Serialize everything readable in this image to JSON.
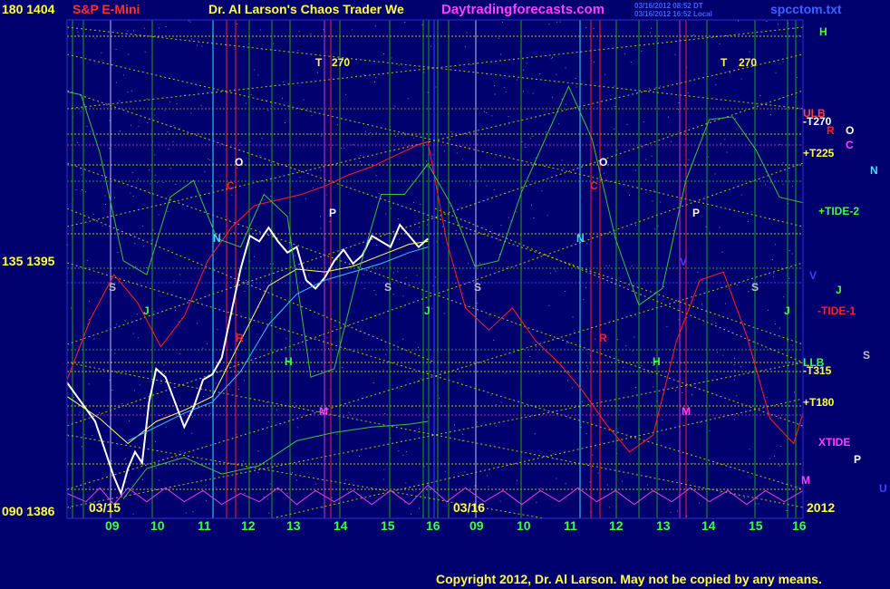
{
  "header": {
    "instrument": "S&P E-Mini",
    "title": "Dr. Al Larson's Chaos Trader We",
    "site": "Daytradingforecasts.com",
    "timestamp_1": "03/16/2012 08:52 DT",
    "timestamp_2": "03/16/2012 16:52 Local",
    "file": "spcctom.txt"
  },
  "copyright": "Copyright 2012, Dr. Al Larson. May not be copied by any means.",
  "y_axis": {
    "ticks": [
      {
        "label": "180  1404",
        "price": 1404
      },
      {
        "label": "135  1395",
        "price": 1395
      },
      {
        "label": "090  1386",
        "price": 1386
      }
    ]
  },
  "x_axis": {
    "day_labels": [
      "03/15",
      "03/16"
    ],
    "year_label": "2012",
    "hour_labels": [
      "09",
      "10",
      "11",
      "12",
      "13",
      "14",
      "15",
      "16",
      "09",
      "10",
      "11",
      "12",
      "13",
      "14",
      "15",
      "16"
    ]
  },
  "right_labels": [
    {
      "text": "H",
      "color": "#40ff40"
    },
    {
      "text": "ULB",
      "color": "#ff4040"
    },
    {
      "text": "-T270",
      "color": "#ffffff"
    },
    {
      "text": "R",
      "color": "#ff2020"
    },
    {
      "text": "O",
      "color": "#ffffff"
    },
    {
      "text": "C",
      "color": "#ff40ff"
    },
    {
      "text": "+T225",
      "color": "#ffff40"
    },
    {
      "text": "N",
      "color": "#40e0ff"
    },
    {
      "text": "+TIDE-2",
      "color": "#40ff40"
    },
    {
      "text": "V",
      "color": "#4040ff"
    },
    {
      "text": "J",
      "color": "#40ff40"
    },
    {
      "text": "-TIDE-1",
      "color": "#ff2020"
    },
    {
      "text": "S",
      "color": "#c0c0c0"
    },
    {
      "text": "LLB",
      "color": "#40ff40"
    },
    {
      "text": "-T315",
      "color": "#ffff40"
    },
    {
      "text": "+T180",
      "color": "#ffff40"
    },
    {
      "text": "XTIDE",
      "color": "#ff40ff"
    },
    {
      "text": "P",
      "color": "#ffffff"
    },
    {
      "text": "M",
      "color": "#ff40ff"
    },
    {
      "text": "U",
      "color": "#4040ff"
    }
  ],
  "plot_markers": [
    {
      "text": "T",
      "color": "#ffff40"
    },
    {
      "text": "270",
      "color": "#ffff40"
    },
    {
      "text": "T",
      "color": "#ffff40"
    },
    {
      "text": "270",
      "color": "#ffff40"
    },
    {
      "text": "O",
      "color": "#ffffff"
    },
    {
      "text": "C",
      "color": "#ff2020"
    },
    {
      "text": "N",
      "color": "#40e0ff"
    },
    {
      "text": "P",
      "color": "#ffffff"
    },
    {
      "text": "S",
      "color": "#c0c0c0"
    },
    {
      "text": "J",
      "color": "#40ff40"
    },
    {
      "text": "R",
      "color": "#ff2020"
    },
    {
      "text": "H",
      "color": "#40ff40"
    },
    {
      "text": "M",
      "color": "#ff40ff"
    },
    {
      "text": "S",
      "color": "#c0c0c0"
    },
    {
      "text": "O",
      "color": "#ffffff"
    },
    {
      "text": "C",
      "color": "#ff2020"
    },
    {
      "text": "N",
      "color": "#40e0ff"
    },
    {
      "text": "P",
      "color": "#ffffff"
    },
    {
      "text": "S",
      "color": "#c0c0c0"
    },
    {
      "text": "S",
      "color": "#c0c0c0"
    },
    {
      "text": "J",
      "color": "#40ff40"
    },
    {
      "text": "R",
      "color": "#ff2020"
    },
    {
      "text": "H",
      "color": "#40ff40"
    },
    {
      "text": "M",
      "color": "#ff40ff"
    },
    {
      "text": "V",
      "color": "#4040ff"
    },
    {
      "text": "J",
      "color": "#40ff40"
    }
  ],
  "chart_data": {
    "type": "line",
    "title": "S&P E-Mini",
    "ylim": [
      1386,
      1404
    ],
    "x_unit": "hour of day (03/15 then 03/16)",
    "series": [
      {
        "kind": "price",
        "color": "#ffffff",
        "points": [
          [
            8.3,
            1390.9
          ],
          [
            8.6,
            1390.2
          ],
          [
            8.9,
            1389.5
          ],
          [
            9.1,
            1388.5
          ],
          [
            9.3,
            1387.5
          ],
          [
            9.45,
            1386.9
          ],
          [
            9.6,
            1387.8
          ],
          [
            9.75,
            1388.4
          ],
          [
            9.9,
            1388.0
          ],
          [
            10.05,
            1390.2
          ],
          [
            10.2,
            1391.4
          ],
          [
            10.4,
            1391.1
          ],
          [
            10.6,
            1390.2
          ],
          [
            10.8,
            1389.3
          ],
          [
            11.0,
            1390.0
          ],
          [
            11.2,
            1391.0
          ],
          [
            11.4,
            1391.2
          ],
          [
            11.6,
            1391.8
          ],
          [
            11.8,
            1393.4
          ],
          [
            12.0,
            1395.0
          ],
          [
            12.2,
            1396.2
          ],
          [
            12.4,
            1396.0
          ],
          [
            12.6,
            1396.5
          ],
          [
            12.8,
            1396.0
          ],
          [
            13.0,
            1395.6
          ],
          [
            13.2,
            1395.8
          ],
          [
            13.4,
            1394.6
          ],
          [
            13.6,
            1394.3
          ],
          [
            13.8,
            1394.7
          ],
          [
            14.0,
            1395.3
          ],
          [
            14.2,
            1395.7
          ],
          [
            14.4,
            1395.2
          ],
          [
            14.6,
            1395.5
          ],
          [
            14.8,
            1396.2
          ],
          [
            15.0,
            1396.0
          ],
          [
            15.2,
            1395.8
          ],
          [
            15.4,
            1396.6
          ],
          [
            15.6,
            1396.2
          ],
          [
            15.8,
            1395.8
          ],
          [
            16.0,
            1396.1
          ]
        ]
      },
      {
        "kind": "moving-average",
        "color": "#ffff60",
        "points": [
          [
            8.3,
            1390.4
          ],
          [
            9.0,
            1389.6
          ],
          [
            9.6,
            1388.7
          ],
          [
            10.2,
            1389.5
          ],
          [
            10.8,
            1389.9
          ],
          [
            11.4,
            1390.4
          ],
          [
            12.0,
            1392.4
          ],
          [
            12.6,
            1394.4
          ],
          [
            13.2,
            1395.0
          ],
          [
            13.8,
            1394.9
          ],
          [
            14.4,
            1395.1
          ],
          [
            15.0,
            1395.5
          ],
          [
            15.6,
            1395.9
          ],
          [
            16.0,
            1396.0
          ]
        ]
      },
      {
        "kind": "moving-average",
        "color": "#40c0ff",
        "points": [
          [
            9.6,
            1388.8
          ],
          [
            10.2,
            1389.3
          ],
          [
            10.8,
            1389.8
          ],
          [
            11.4,
            1390.2
          ],
          [
            12.0,
            1391.3
          ],
          [
            12.6,
            1393.0
          ],
          [
            13.2,
            1394.1
          ],
          [
            13.8,
            1394.6
          ],
          [
            14.4,
            1394.9
          ],
          [
            15.0,
            1395.2
          ],
          [
            15.6,
            1395.6
          ],
          [
            16.0,
            1395.8
          ]
        ]
      },
      {
        "kind": "forecast-cycle",
        "color": "#ff2020",
        "points": [
          [
            8.3,
            1391.0
          ],
          [
            8.8,
            1393.2
          ],
          [
            9.3,
            1394.8
          ],
          [
            9.8,
            1393.8
          ],
          [
            10.3,
            1392.2
          ],
          [
            10.8,
            1393.3
          ],
          [
            11.3,
            1395.3
          ],
          [
            11.8,
            1396.5
          ],
          [
            12.3,
            1397.3
          ],
          [
            12.8,
            1397.5
          ],
          [
            13.3,
            1397.7
          ],
          [
            13.8,
            1398.0
          ],
          [
            14.3,
            1398.4
          ],
          [
            14.8,
            1398.7
          ],
          [
            15.3,
            1399.1
          ],
          [
            15.8,
            1399.5
          ],
          [
            16.0,
            1399.6
          ],
          [
            16.4,
            1396.0
          ],
          [
            16.8,
            1393.6
          ],
          [
            17.3,
            1392.8
          ],
          [
            17.8,
            1393.6
          ],
          [
            18.3,
            1392.4
          ],
          [
            18.8,
            1391.6
          ],
          [
            19.3,
            1390.6
          ],
          [
            19.8,
            1389.4
          ],
          [
            20.3,
            1388.4
          ],
          [
            20.8,
            1389.0
          ],
          [
            21.3,
            1392.4
          ],
          [
            21.8,
            1394.6
          ],
          [
            22.3,
            1394.9
          ],
          [
            22.8,
            1392.6
          ],
          [
            23.3,
            1389.6
          ],
          [
            23.8,
            1388.7
          ],
          [
            24.0,
            1389.8
          ]
        ]
      },
      {
        "kind": "forecast-cycle",
        "color": "#40c040",
        "points": [
          [
            8.3,
            1401.4
          ],
          [
            8.6,
            1401.3
          ],
          [
            9.0,
            1399.2
          ],
          [
            9.5,
            1395.3
          ],
          [
            10.0,
            1394.8
          ],
          [
            10.5,
            1397.6
          ],
          [
            11.0,
            1398.2
          ],
          [
            11.5,
            1396.1
          ],
          [
            12.0,
            1395.8
          ],
          [
            12.5,
            1397.7
          ],
          [
            13.0,
            1396.9
          ],
          [
            13.5,
            1391.1
          ],
          [
            14.0,
            1391.4
          ],
          [
            14.5,
            1394.8
          ],
          [
            15.0,
            1397.7
          ],
          [
            15.5,
            1397.7
          ],
          [
            16.0,
            1398.8
          ],
          [
            16.5,
            1397.3
          ],
          [
            17.0,
            1395.1
          ],
          [
            17.5,
            1395.3
          ],
          [
            18.0,
            1397.8
          ],
          [
            18.5,
            1399.7
          ],
          [
            19.0,
            1401.6
          ],
          [
            19.5,
            1399.7
          ],
          [
            20.0,
            1396.1
          ],
          [
            20.5,
            1393.7
          ],
          [
            21.0,
            1394.3
          ],
          [
            21.5,
            1398.2
          ],
          [
            22.0,
            1400.4
          ],
          [
            22.5,
            1400.5
          ],
          [
            23.0,
            1399.3
          ],
          [
            23.5,
            1397.6
          ],
          [
            24.0,
            1397.4
          ]
        ]
      },
      {
        "kind": "envelope",
        "color": "#40c040",
        "points": [
          [
            9.5,
            1386.7
          ],
          [
            10.0,
            1387.8
          ],
          [
            10.8,
            1388.2
          ],
          [
            11.6,
            1387.6
          ],
          [
            12.4,
            1387.9
          ],
          [
            13.2,
            1388.8
          ],
          [
            14.0,
            1389.1
          ],
          [
            14.8,
            1389.3
          ],
          [
            15.6,
            1389.4
          ],
          [
            16.0,
            1389.5
          ]
        ]
      },
      {
        "kind": "xtide-oscillator",
        "color": "#e040e0",
        "points": [
          [
            8.3,
            1386.9
          ],
          [
            8.7,
            1386.6
          ],
          [
            9.0,
            1387.1
          ],
          [
            9.3,
            1386.5
          ],
          [
            9.6,
            1387.1
          ],
          [
            10.0,
            1386.6
          ],
          [
            10.4,
            1387.1
          ],
          [
            10.8,
            1386.6
          ],
          [
            11.2,
            1387.0
          ],
          [
            11.6,
            1386.5
          ],
          [
            12.0,
            1386.9
          ],
          [
            12.4,
            1386.6
          ],
          [
            12.8,
            1387.1
          ],
          [
            13.2,
            1386.5
          ],
          [
            13.6,
            1387.0
          ],
          [
            14.0,
            1386.6
          ],
          [
            14.4,
            1387.0
          ],
          [
            14.8,
            1386.5
          ],
          [
            15.2,
            1387.0
          ],
          [
            15.6,
            1386.5
          ],
          [
            16.0,
            1387.2
          ],
          [
            16.4,
            1386.6
          ],
          [
            16.8,
            1387.1
          ],
          [
            17.2,
            1386.6
          ],
          [
            17.6,
            1387.0
          ],
          [
            18.0,
            1386.5
          ],
          [
            18.4,
            1387.0
          ],
          [
            18.8,
            1386.6
          ],
          [
            19.2,
            1387.1
          ],
          [
            19.6,
            1386.6
          ],
          [
            20.0,
            1387.0
          ],
          [
            20.4,
            1386.5
          ],
          [
            20.8,
            1387.0
          ],
          [
            21.2,
            1386.6
          ],
          [
            21.6,
            1387.1
          ],
          [
            22.0,
            1386.6
          ],
          [
            22.4,
            1387.0
          ],
          [
            22.8,
            1386.5
          ],
          [
            23.2,
            1387.0
          ],
          [
            23.6,
            1386.6
          ],
          [
            24.0,
            1387.0
          ]
        ]
      }
    ]
  }
}
